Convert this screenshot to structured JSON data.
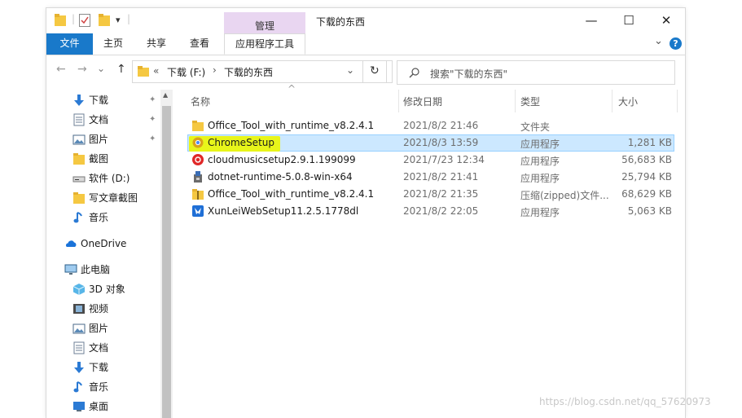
{
  "window": {
    "title": "下载的东西",
    "context_group": "管理",
    "minimize": "—",
    "maximize": "☐",
    "close": "✕"
  },
  "ribbon": {
    "tabs": [
      {
        "label": "文件"
      },
      {
        "label": "主页"
      },
      {
        "label": "共享"
      },
      {
        "label": "查看"
      },
      {
        "label": "应用程序工具"
      }
    ],
    "expand": "⌄",
    "help": "?"
  },
  "quick_access": {
    "dropdown": "▾"
  },
  "address": {
    "back": "←",
    "forward": "→",
    "recent": "⌄",
    "up": "↑",
    "overflow": "«",
    "crumbs": [
      "下载 (F:)",
      "下载的东西"
    ],
    "separator": "›",
    "dropdown": "⌄",
    "refresh": "↻"
  },
  "search": {
    "placeholder": "搜索\"下载的东西\""
  },
  "nav": {
    "quick": [
      {
        "label": "下载",
        "icon": "download-arrow-icon",
        "pinned": true
      },
      {
        "label": "文档",
        "icon": "document-icon",
        "pinned": true
      },
      {
        "label": "图片",
        "icon": "picture-icon",
        "pinned": true
      },
      {
        "label": "截图",
        "icon": "folder-icon",
        "pinned": false
      },
      {
        "label": "软件 (D:)",
        "icon": "drive-icon",
        "pinned": false
      },
      {
        "label": "写文章截图",
        "icon": "folder-icon",
        "pinned": false
      },
      {
        "label": "音乐",
        "icon": "music-icon",
        "pinned": false
      }
    ],
    "onedrive": "OneDrive",
    "this_pc": "此电脑",
    "pc_items": [
      {
        "label": "3D 对象",
        "icon": "3d-objects-icon"
      },
      {
        "label": "视频",
        "icon": "video-icon"
      },
      {
        "label": "图片",
        "icon": "picture-icon"
      },
      {
        "label": "文档",
        "icon": "document-icon"
      },
      {
        "label": "下载",
        "icon": "download-arrow-icon"
      },
      {
        "label": "音乐",
        "icon": "music-icon"
      },
      {
        "label": "桌面",
        "icon": "desktop-icon"
      }
    ],
    "pin_glyph": "📌"
  },
  "columns": {
    "name": "名称",
    "modified": "修改日期",
    "type": "类型",
    "size": "大小",
    "sort_glyph": "^"
  },
  "files": [
    {
      "name": "Office_Tool_with_runtime_v8.2.4.1",
      "modified": "2021/8/2 21:46",
      "type": "文件夹",
      "size": "",
      "icon": "folder-icon"
    },
    {
      "name": "ChromeSetup",
      "modified": "2021/8/3 13:59",
      "type": "应用程序",
      "size": "1,281 KB",
      "icon": "chrome-setup-icon"
    },
    {
      "name": "cloudmusicsetup2.9.1.199099",
      "modified": "2021/7/23 12:34",
      "type": "应用程序",
      "size": "56,683 KB",
      "icon": "netease-music-icon"
    },
    {
      "name": "dotnet-runtime-5.0.8-win-x64",
      "modified": "2021/8/2 21:41",
      "type": "应用程序",
      "size": "25,794 KB",
      "icon": "installer-icon"
    },
    {
      "name": "Office_Tool_with_runtime_v8.2.4.1",
      "modified": "2021/8/2 21:35",
      "type": "压缩(zipped)文件...",
      "size": "68,629 KB",
      "icon": "zip-folder-icon"
    },
    {
      "name": "XunLeiWebSetup11.2.5.1778dl",
      "modified": "2021/8/2 22:05",
      "type": "应用程序",
      "size": "5,063 KB",
      "icon": "xunlei-icon"
    }
  ],
  "selected_index": 1,
  "watermark": "https://blog.csdn.net/qq_57620973",
  "colors": {
    "accent": "#1979ca",
    "selection": "#cce8ff",
    "highlight": "#e8f51a",
    "context_tab": "#e9d6f1"
  }
}
